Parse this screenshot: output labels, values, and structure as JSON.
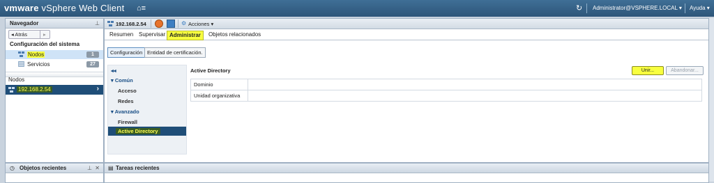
{
  "header": {
    "brand": "vmware",
    "product": "vSphere Web Client",
    "home_icon": "home-menu-icon",
    "refresh_icon": "refresh-icon",
    "user": "Administrator@VSPHERE.LOCAL ▾",
    "help": "Ayuda ▾"
  },
  "navigator": {
    "title": "Navegador",
    "back_label": "◂ Atrás",
    "section_title": "Configuración del sistema",
    "items": [
      {
        "label": "Nodos",
        "count": "1",
        "icon": "nodes-icon"
      },
      {
        "label": "Servicios",
        "count": "27",
        "icon": "services-icon"
      }
    ],
    "nodes_header": "Nodos",
    "selected_node": "192.168.2.54"
  },
  "main": {
    "host": "192.168.2.54",
    "actions_label": "Acciones ▾",
    "tabs": [
      "Resumen",
      "Supervisar",
      "Administrar",
      "Objetos relacionados"
    ],
    "active_tab": "Administrar",
    "subtabs": [
      "Configuración",
      "Entidad de certificación."
    ],
    "left_nav": {
      "collapse": "◂◂",
      "common": "▾ Común",
      "access": "Acceso",
      "networks": "Redes",
      "advanced": "▾ Avanzado",
      "firewall": "Firewall",
      "ad": "Active Directory"
    },
    "ad_panel": {
      "title": "Active Directory",
      "join_button": "Unir...",
      "leave_button": "Abandonar...",
      "rows": [
        {
          "label": "Dominio",
          "value": ""
        },
        {
          "label": "Unidad organizativa",
          "value": ""
        }
      ]
    }
  },
  "recent_objects": {
    "title": "Objetos recientes"
  },
  "recent_tasks": {
    "title": "Tareas recientes"
  },
  "colors": {
    "accent_blue": "#1f4e78",
    "highlight_yellow": "#f8ff3f",
    "header_blue": "#2d5579"
  }
}
